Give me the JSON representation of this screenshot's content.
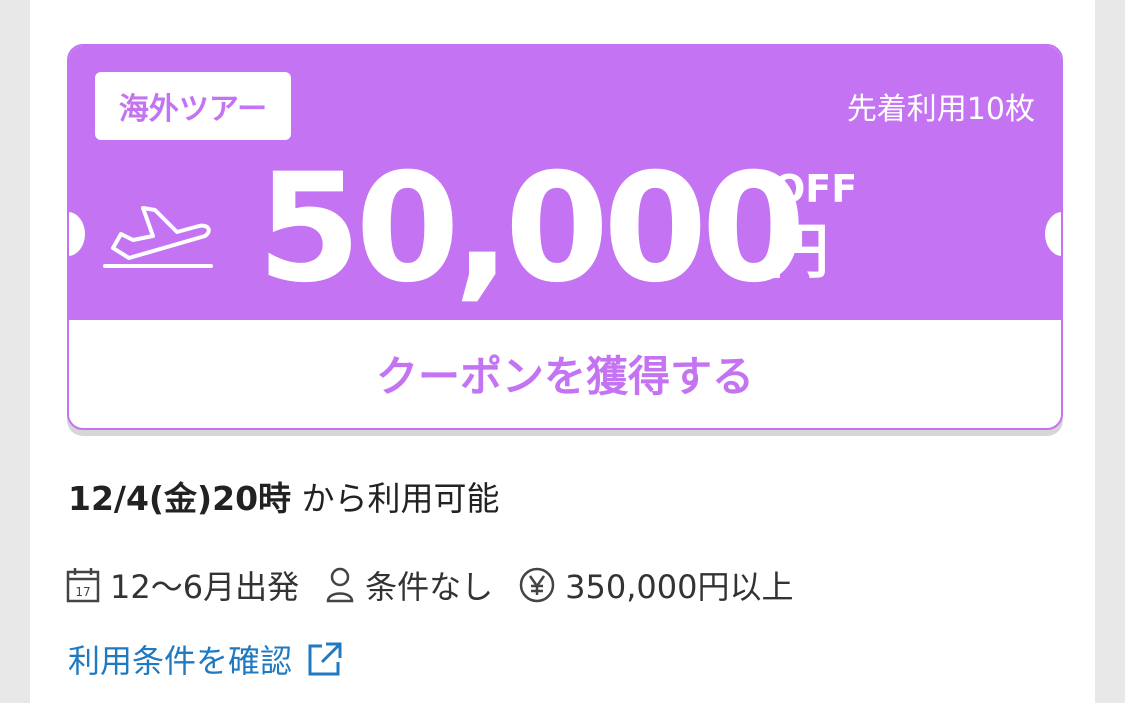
{
  "coupon": {
    "badge": "海外ツアー",
    "limit": "先着利用10枚",
    "amount": "50,000",
    "off_label": "OFF",
    "currency": "円",
    "button_label": "クーポンを獲得する"
  },
  "availability": {
    "date": "12/4(金)20時",
    "suffix": " から利用可能"
  },
  "conditions": [
    {
      "icon": "calendar-icon",
      "text": "12〜6月出発"
    },
    {
      "icon": "person-icon",
      "text": "条件なし"
    },
    {
      "icon": "yen-icon",
      "text": "350,000円以上"
    }
  ],
  "terms_link": "利用条件を確認",
  "colors": {
    "accent": "#c473f2",
    "link": "#1f7ac2"
  }
}
